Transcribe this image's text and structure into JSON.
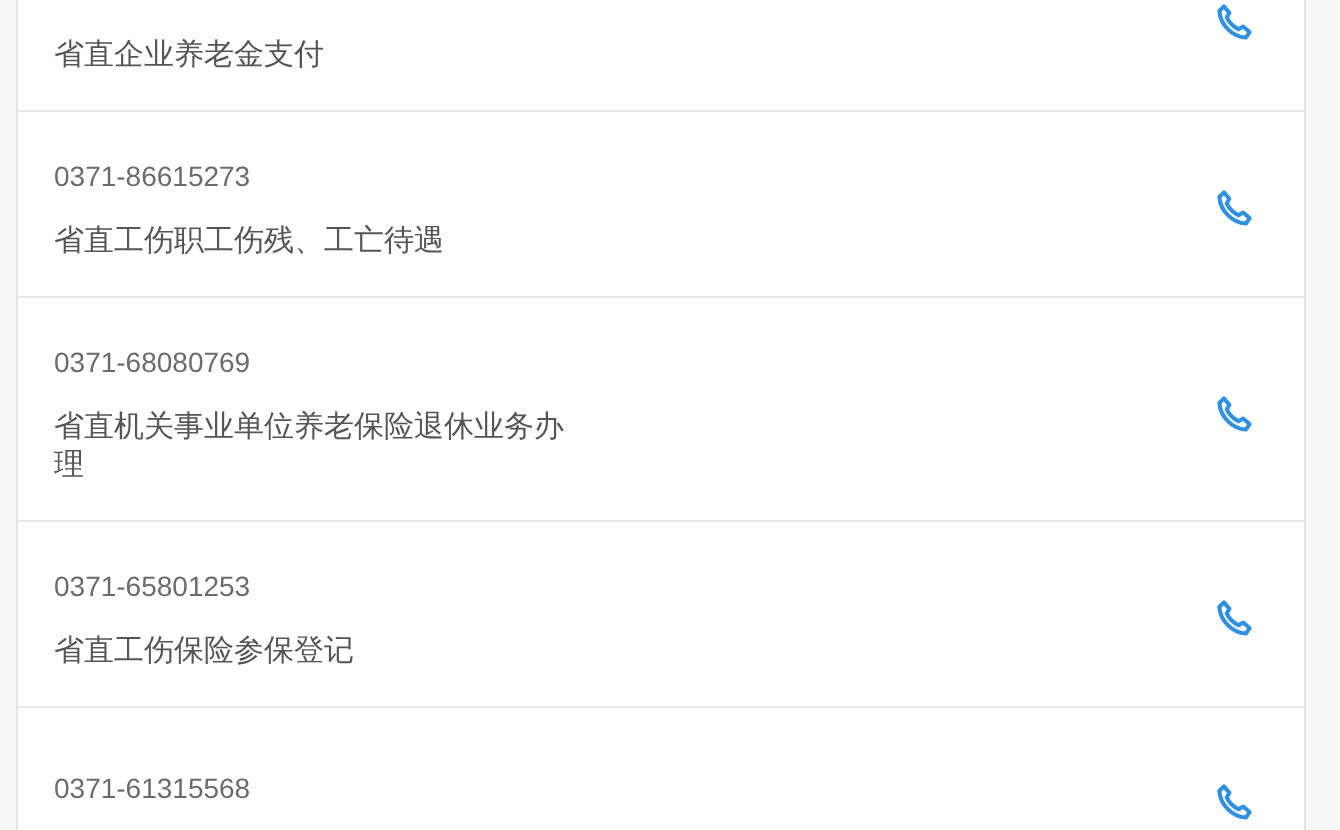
{
  "contacts": [
    {
      "description": "省直企业养老金支付"
    },
    {
      "phone": "0371-86615273",
      "description": "省直工伤职工伤残、工亡待遇"
    },
    {
      "phone": "0371-68080769",
      "description": "省直机关事业单位养老保险退休业务办理"
    },
    {
      "phone": "0371-65801253",
      "description": "省直工伤保险参保登记"
    },
    {
      "phone": "0371-61315568"
    }
  ]
}
